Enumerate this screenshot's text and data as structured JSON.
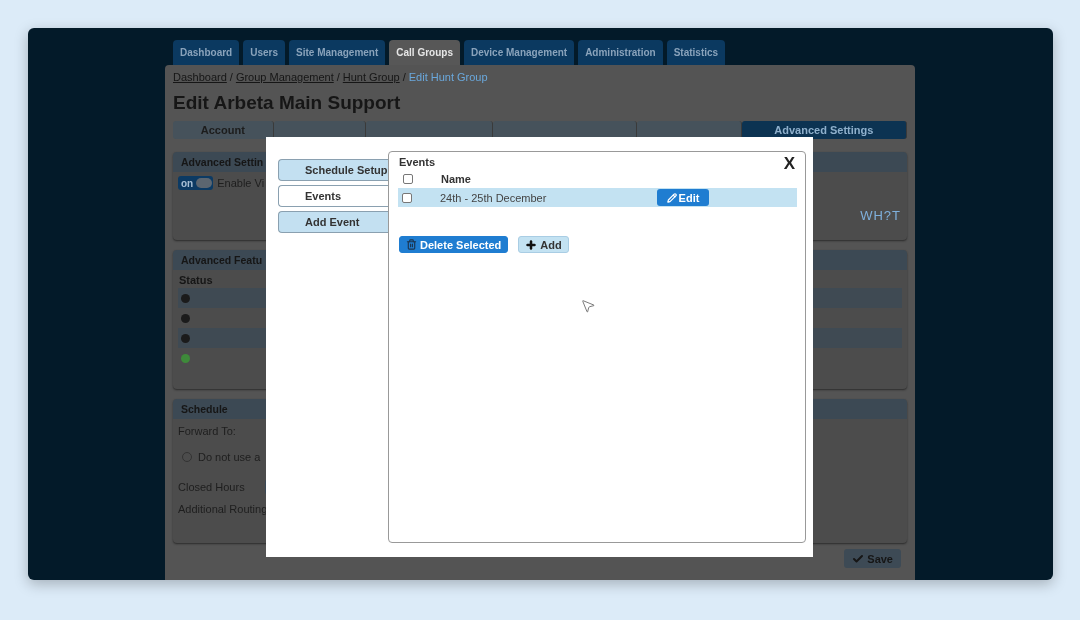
{
  "nav_tabs": [
    {
      "label": "Dashboard",
      "selected": false
    },
    {
      "label": "Users",
      "selected": false
    },
    {
      "label": "Site Management",
      "selected": false
    },
    {
      "label": "Call Groups",
      "selected": true
    },
    {
      "label": "Device Management",
      "selected": false
    },
    {
      "label": "Administration",
      "selected": false
    },
    {
      "label": "Statistics",
      "selected": false
    }
  ],
  "breadcrumb": [
    {
      "label": "Dashboard",
      "link": true
    },
    {
      "label": "Group Management",
      "link": true
    },
    {
      "label": "Hunt Group",
      "link": true
    },
    {
      "label": "Edit Hunt Group",
      "link": false
    }
  ],
  "breadcrumb_separator": "/",
  "title": "Edit Arbeta Main Support",
  "sub_tabs": [
    {
      "label": "Account",
      "selected": false
    },
    {
      "selected": false
    },
    {
      "selected": false
    },
    {
      "selected": false
    },
    {
      "selected": false
    },
    {
      "label": "Advanced Settings",
      "selected": true
    }
  ],
  "advanced_settings": {
    "title": "Advanced Settin",
    "toggle": {
      "label": "on",
      "on": true
    },
    "toggle_text": "Enable Vi",
    "logo": "WH?T"
  },
  "advanced_features": {
    "title": "Advanced Featu",
    "columns": [
      "Status"
    ],
    "rows": [
      {
        "on": false
      },
      {
        "on": false
      },
      {
        "on": false
      },
      {
        "on": true
      }
    ]
  },
  "schedule": {
    "title": "Schedule",
    "forward_label": "Forward To:",
    "radio": {
      "label": "Do not use a",
      "selected": false
    },
    "closed_hours": {
      "label": "Closed Hours"
    },
    "additional_routing": "Additional Routing"
  },
  "save": "Save",
  "modal": {
    "side_tabs": [
      {
        "label": "Schedule Setup",
        "selected": false
      },
      {
        "label": "Events",
        "selected": true
      },
      {
        "label": "Add Event",
        "selected": false
      }
    ],
    "heading": "Events",
    "close": "X",
    "column": "Name",
    "header_checked": false,
    "rows": [
      {
        "name": "24th - 25th December",
        "checked": false,
        "selected": true,
        "action": "Edit"
      }
    ],
    "buttons": [
      {
        "label": "Delete Selected",
        "kind": "primary"
      },
      {
        "label": "Add",
        "kind": "secondary"
      }
    ]
  }
}
